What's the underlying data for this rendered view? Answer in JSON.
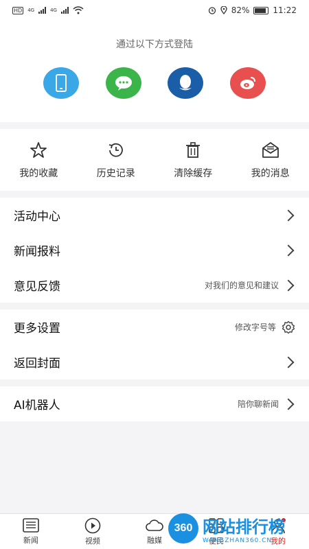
{
  "status": {
    "battery": "82%",
    "time": "11:22",
    "net1": "4G",
    "net2": "4G",
    "hd": "HD"
  },
  "login": {
    "title": "通过以下方式登陆",
    "methods": [
      {
        "icon": "phone-icon",
        "color": "#3aa8e6"
      },
      {
        "icon": "wechat-icon",
        "color": "#3bb54a"
      },
      {
        "icon": "qq-icon",
        "color": "#1b5ea8"
      },
      {
        "icon": "weibo-icon",
        "color": "#e8504f"
      }
    ]
  },
  "quick": [
    {
      "label": "我的收藏",
      "icon": "star-icon"
    },
    {
      "label": "历史记录",
      "icon": "history-icon"
    },
    {
      "label": "清除缓存",
      "icon": "trash-icon"
    },
    {
      "label": "我的消息",
      "icon": "mail-icon"
    }
  ],
  "menu1": [
    {
      "title": "活动中心",
      "sub": ""
    },
    {
      "title": "新闻报料",
      "sub": ""
    },
    {
      "title": "意见反馈",
      "sub": "对我们的意见和建议"
    }
  ],
  "menu2": [
    {
      "title": "更多设置",
      "sub": "修改字号等"
    },
    {
      "title": "返回封面",
      "sub": ""
    }
  ],
  "menu3": [
    {
      "title": "AI机器人",
      "sub": "陪你聊新闻"
    }
  ],
  "tabs": [
    {
      "label": "新闻",
      "icon": "news-icon"
    },
    {
      "label": "视频",
      "icon": "video-icon"
    },
    {
      "label": "融媒",
      "icon": "cloud-icon"
    },
    {
      "label": "便民",
      "icon": "apps-icon"
    },
    {
      "label": "我的",
      "icon": "user-icon"
    }
  ],
  "watermark": {
    "logo": "360",
    "title": "网站排行榜",
    "sub": "WANGZHAN360.CN"
  }
}
